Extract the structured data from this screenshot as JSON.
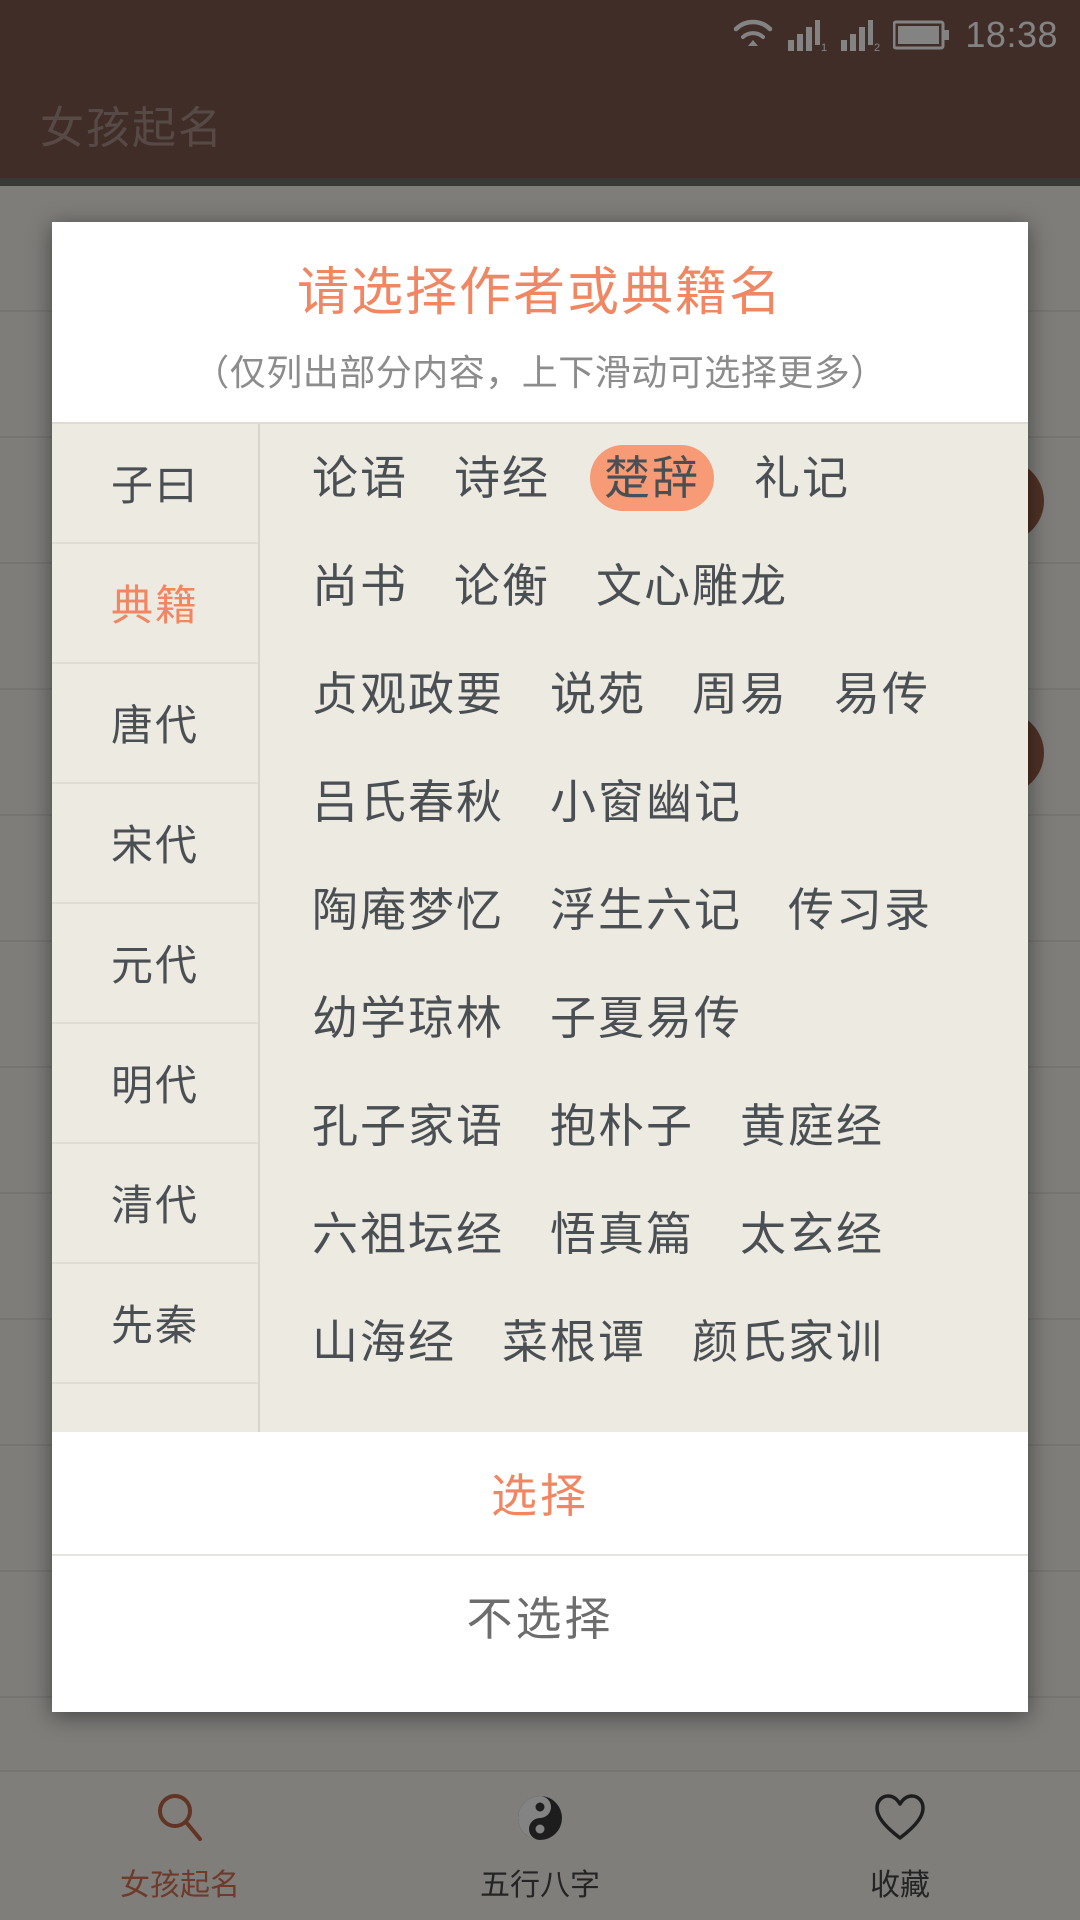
{
  "status_bar": {
    "time": "18:38",
    "icons": [
      "wifi-icon",
      "signal-1-icon",
      "signal-2-icon",
      "battery-icon"
    ]
  },
  "app": {
    "title": "女孩起名",
    "header_bg": "#6a4034"
  },
  "dialog": {
    "title": "请选择作者或典籍名",
    "subtitle": "（仅列出部分内容，上下滑动可选择更多）",
    "accent": "#f08662",
    "highlight": "#f79b77",
    "categories": [
      {
        "label": "子曰",
        "selected": false
      },
      {
        "label": "典籍",
        "selected": true
      },
      {
        "label": "唐代",
        "selected": false
      },
      {
        "label": "宋代",
        "selected": false
      },
      {
        "label": "元代",
        "selected": false
      },
      {
        "label": "明代",
        "selected": false
      },
      {
        "label": "清代",
        "selected": false
      },
      {
        "label": "先秦",
        "selected": false
      }
    ],
    "book_rows": [
      [
        {
          "label": "论语",
          "selected": false
        },
        {
          "label": "诗经",
          "selected": false
        },
        {
          "label": "楚辞",
          "selected": true
        },
        {
          "label": "礼记",
          "selected": false
        }
      ],
      [
        {
          "label": "尚书",
          "selected": false
        },
        {
          "label": "论衡",
          "selected": false
        },
        {
          "label": "文心雕龙",
          "selected": false
        }
      ],
      [
        {
          "label": "贞观政要",
          "selected": false
        },
        {
          "label": "说苑",
          "selected": false
        },
        {
          "label": "周易",
          "selected": false
        },
        {
          "label": "易传",
          "selected": false
        }
      ],
      [
        {
          "label": "吕氏春秋",
          "selected": false
        },
        {
          "label": "小窗幽记",
          "selected": false
        }
      ],
      [
        {
          "label": "陶庵梦忆",
          "selected": false
        },
        {
          "label": "浮生六记",
          "selected": false
        },
        {
          "label": "传习录",
          "selected": false
        }
      ],
      [
        {
          "label": "幼学琼林",
          "selected": false
        },
        {
          "label": "子夏易传",
          "selected": false
        }
      ],
      [
        {
          "label": "孔子家语",
          "selected": false
        },
        {
          "label": "抱朴子",
          "selected": false
        },
        {
          "label": "黄庭经",
          "selected": false
        }
      ],
      [
        {
          "label": "六祖坛经",
          "selected": false
        },
        {
          "label": "悟真篇",
          "selected": false
        },
        {
          "label": "太玄经",
          "selected": false
        }
      ],
      [
        {
          "label": "山海经",
          "selected": false
        },
        {
          "label": "菜根谭",
          "selected": false
        },
        {
          "label": "颜氏家训",
          "selected": false
        }
      ]
    ],
    "confirm_label": "选择",
    "cancel_label": "不选择"
  },
  "bottom_nav": {
    "items": [
      {
        "label": "女孩起名",
        "icon": "search-icon",
        "active": true
      },
      {
        "label": "五行八字",
        "icon": "yinyang-icon",
        "active": false
      },
      {
        "label": "收藏",
        "icon": "heart-icon",
        "active": false
      }
    ]
  }
}
